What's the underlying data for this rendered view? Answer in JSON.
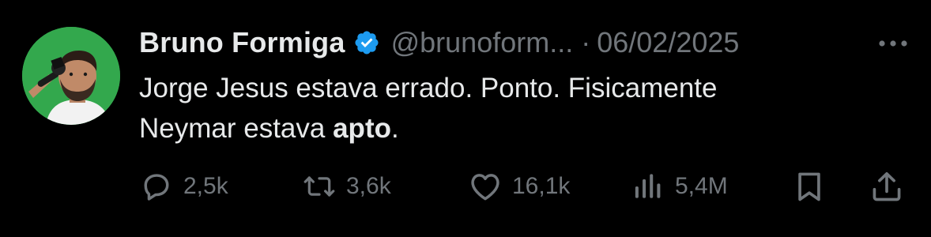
{
  "author": {
    "display_name": "Bruno Formiga",
    "verified_icon": "verified-badge-icon",
    "handle": "@brunoform...",
    "separator": "·",
    "date": "06/02/2025"
  },
  "tweet": {
    "text_line1": "Jorge Jesus estava errado. Ponto. Fisicamente",
    "text_line2_prefix": "Neymar estava ",
    "text_line2_bold": "apto",
    "text_line2_suffix": "."
  },
  "actions": {
    "replies": {
      "icon": "reply-icon",
      "count": "2,5k"
    },
    "reposts": {
      "icon": "repost-icon",
      "count": "3,6k"
    },
    "likes": {
      "icon": "like-icon",
      "count": "16,1k"
    },
    "views": {
      "icon": "views-icon",
      "count": "5,4M"
    },
    "bookmark": {
      "icon": "bookmark-icon"
    },
    "share": {
      "icon": "share-icon"
    }
  },
  "colors": {
    "background": "#000000",
    "primary_text": "#e7e9ea",
    "secondary_text": "#71767b",
    "verified": "#1d9bf0",
    "avatar_bg": "#2fa24a"
  }
}
